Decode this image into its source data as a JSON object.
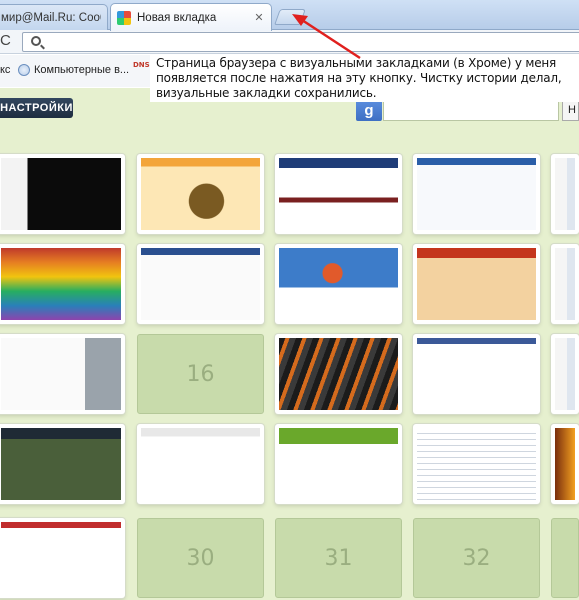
{
  "tabs": [
    {
      "title": "мир@Mail.Ru: Сооб",
      "active": false
    },
    {
      "title": "Новая вкладка",
      "active": true
    }
  ],
  "toolbar": {
    "reload_glyph": "C"
  },
  "bookmarks": [
    {
      "label": "кс"
    },
    {
      "label": "Компьютерные в..."
    },
    {
      "label": "DNS"
    }
  ],
  "annotation": {
    "text": "Страница браузера с визуальными закладками (в Хроме) у меня появляется после нажатия на эту кнопку. Чистку истории делал, визуальные закладки сохранились."
  },
  "page": {
    "settings_label": "НАСТРОЙКИ",
    "google_label": "g",
    "search_button_label": "Н"
  },
  "tiles": [
    {
      "type": "thumb",
      "theme": "dark"
    },
    {
      "type": "thumb",
      "theme": "orange"
    },
    {
      "type": "thumb",
      "theme": "blueweb"
    },
    {
      "type": "thumb",
      "theme": "whiteblue"
    },
    {
      "type": "thumb",
      "theme": "partial"
    },
    {
      "type": "thumb",
      "theme": "rainbow"
    },
    {
      "type": "thumb",
      "theme": "portal"
    },
    {
      "type": "thumb",
      "theme": "balloon"
    },
    {
      "type": "thumb",
      "theme": "redframe"
    },
    {
      "type": "thumb",
      "theme": "partial"
    },
    {
      "type": "thumb",
      "theme": "gray"
    },
    {
      "type": "empty",
      "label": "16"
    },
    {
      "type": "thumb",
      "theme": "stripes"
    },
    {
      "type": "thumb",
      "theme": "social"
    },
    {
      "type": "thumb",
      "theme": "partial"
    },
    {
      "type": "thumb",
      "theme": "darkgreen"
    },
    {
      "type": "thumb",
      "theme": "bigportal"
    },
    {
      "type": "thumb",
      "theme": "greenhead"
    },
    {
      "type": "thumb",
      "theme": "textdoc"
    },
    {
      "type": "thumb",
      "theme": "orangepart"
    },
    {
      "type": "thumb",
      "theme": "doclist"
    },
    {
      "type": "empty",
      "label": "30"
    },
    {
      "type": "empty",
      "label": "31"
    },
    {
      "type": "empty",
      "label": "32"
    },
    {
      "type": "empty",
      "label": ""
    }
  ]
}
